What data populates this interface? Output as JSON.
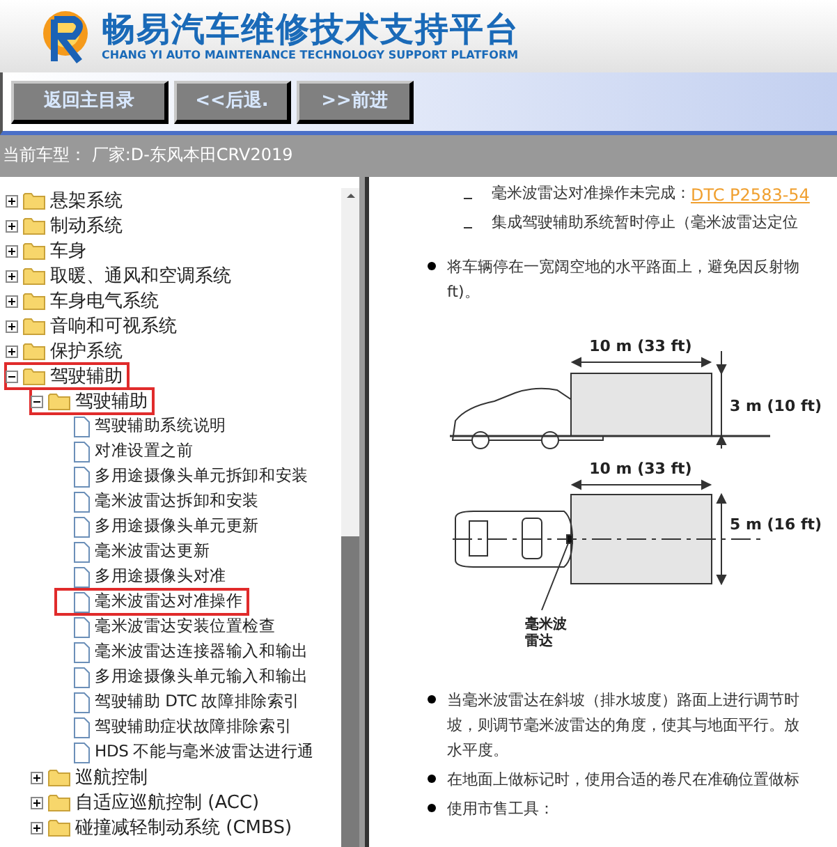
{
  "header": {
    "title": "畅易汽车维修技术支持平台",
    "subtitle": "CHANG YI AUTO MAINTENANCE TECHNOLOGY SUPPORT PLATFORM"
  },
  "nav_buttons": [
    "返回主目录",
    "<<后退.",
    ">>前进"
  ],
  "current_model": "当前车型： 厂家:D-东风本田CRV2019",
  "tree": [
    {
      "kind": "folder",
      "label": "悬架系统",
      "expanded": false,
      "highlighted": false
    },
    {
      "kind": "folder",
      "label": "制动系统",
      "expanded": false,
      "highlighted": false
    },
    {
      "kind": "folder",
      "label": "车身",
      "expanded": false,
      "highlighted": false
    },
    {
      "kind": "folder",
      "label": "取暖、通风和空调系统",
      "expanded": false,
      "highlighted": false
    },
    {
      "kind": "folder",
      "label": "车身电气系统",
      "expanded": false,
      "highlighted": false
    },
    {
      "kind": "folder",
      "label": "音响和可视系统",
      "expanded": false,
      "highlighted": false
    },
    {
      "kind": "folder",
      "label": "保护系统",
      "expanded": false,
      "highlighted": false
    },
    {
      "kind": "folder",
      "label": "驾驶辅助",
      "expanded": true,
      "highlighted": true,
      "children": [
        {
          "kind": "folder",
          "label": "驾驶辅助",
          "expanded": true,
          "highlighted": true,
          "children": [
            {
              "kind": "page",
              "label": "驾驶辅助系统说明",
              "highlighted": false
            },
            {
              "kind": "page",
              "label": "对准设置之前",
              "highlighted": false
            },
            {
              "kind": "page",
              "label": "多用途摄像头单元拆卸和安装",
              "highlighted": false
            },
            {
              "kind": "page",
              "label": "毫米波雷达拆卸和安装",
              "highlighted": false
            },
            {
              "kind": "page",
              "label": "多用途摄像头单元更新",
              "highlighted": false
            },
            {
              "kind": "page",
              "label": "毫米波雷达更新",
              "highlighted": false
            },
            {
              "kind": "page",
              "label": "多用途摄像头对准",
              "highlighted": false
            },
            {
              "kind": "page",
              "label": "毫米波雷达对准操作",
              "highlighted": true
            },
            {
              "kind": "page",
              "label": "毫米波雷达安装位置检查",
              "highlighted": false
            },
            {
              "kind": "page",
              "label": "毫米波雷达连接器输入和输出",
              "highlighted": false
            },
            {
              "kind": "page",
              "label": "多用途摄像头单元输入和输出",
              "highlighted": false
            },
            {
              "kind": "page",
              "label": "驾驶辅助 DTC 故障排除索引",
              "highlighted": false
            },
            {
              "kind": "page",
              "label": "驾驶辅助症状故障排除索引",
              "highlighted": false
            },
            {
              "kind": "page",
              "label": "HDS 不能与毫米波雷达进行通",
              "highlighted": false
            }
          ]
        },
        {
          "kind": "folder",
          "label": "巡航控制",
          "expanded": false,
          "highlighted": false
        },
        {
          "kind": "folder",
          "label": "自适应巡航控制 (ACC)",
          "expanded": false,
          "highlighted": false
        },
        {
          "kind": "folder",
          "label": "碰撞减轻制动系统 (CMBS)",
          "expanded": false,
          "highlighted": false
        }
      ]
    }
  ],
  "content": {
    "dash_items": [
      {
        "text": "毫米波雷达对准操作未完成：",
        "link": "DTC P2583-54"
      },
      {
        "text": "集成驾驶辅助系统暂时停止（毫米波雷达定位"
      }
    ],
    "bullet_1": [
      "将车辆停在一宽阔空地的水平路面上，避免因反射物",
      "ft)。"
    ],
    "diagram": {
      "side_length": "10 m (33 ft)",
      "side_height": "3 m (10 ft)",
      "top_length": "10 m (33 ft)",
      "top_width": "5 m (16 ft)",
      "radar_label": [
        "毫米波",
        "雷达"
      ]
    },
    "bullets": [
      [
        "当毫米波雷达在斜坡（排水坡度）路面上进行调节时",
        "坡，则调节毫米波雷达的角度，使其与地面平行。放",
        "水平度。"
      ],
      [
        "在地面上做标记时，使用合适的卷尺在准确位置做标"
      ],
      [
        "使用市售工具："
      ]
    ]
  }
}
